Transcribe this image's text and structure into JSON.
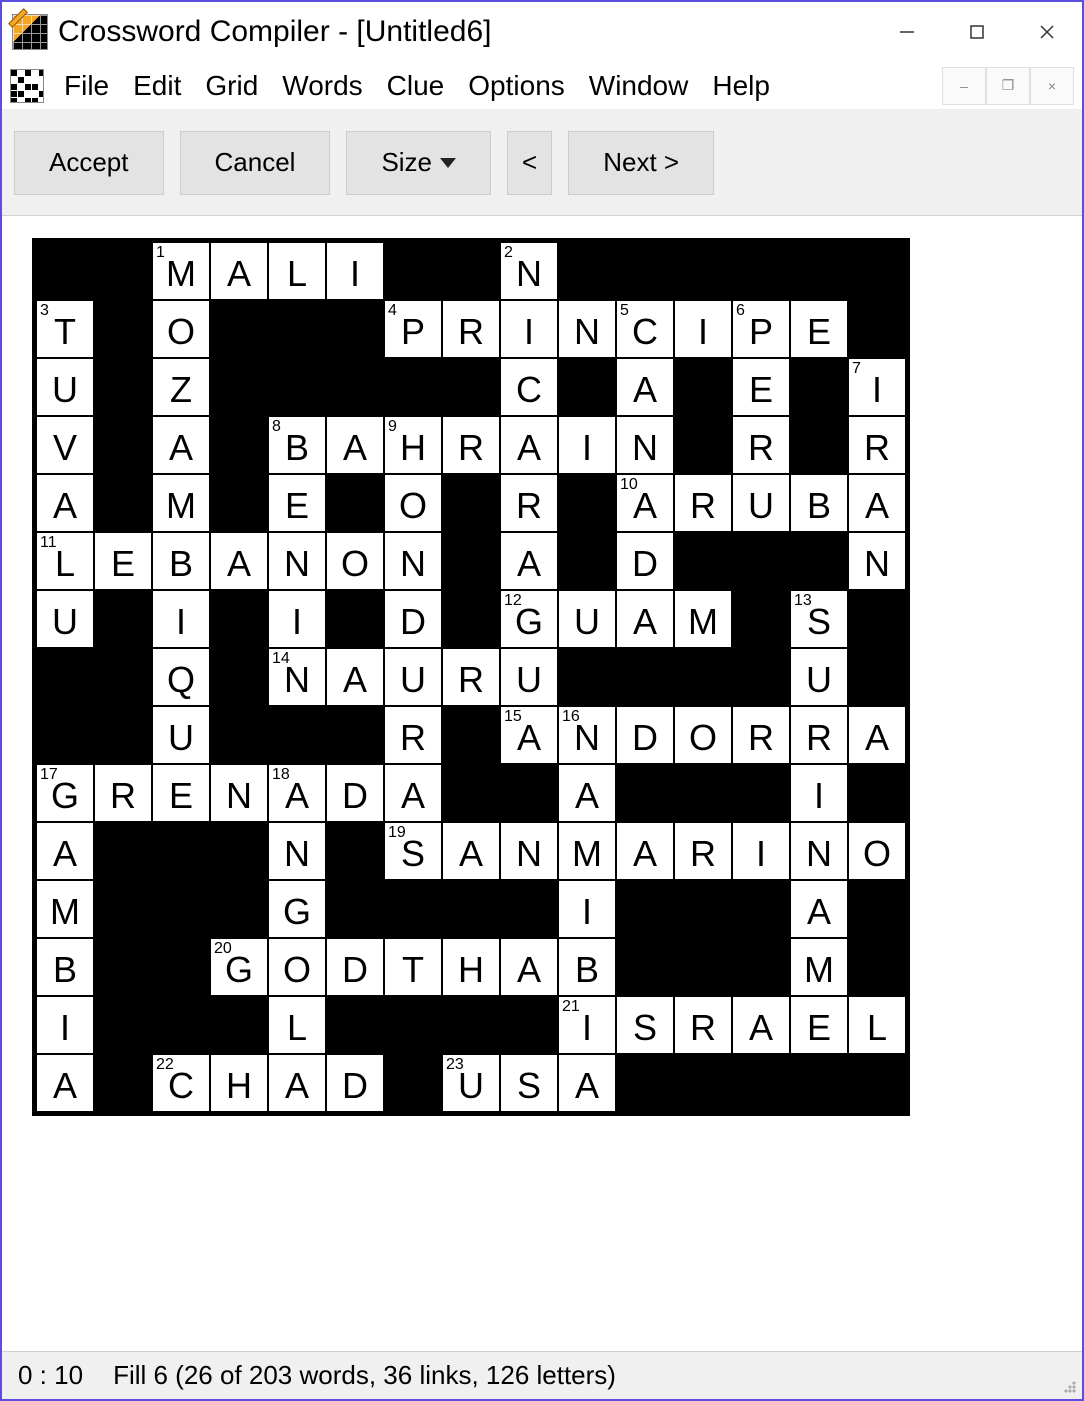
{
  "title": "Crossword Compiler - [Untitled6]",
  "menu": {
    "file": "File",
    "edit": "Edit",
    "grid": "Grid",
    "words": "Words",
    "clue": "Clue",
    "options": "Options",
    "window": "Window",
    "help": "Help"
  },
  "toolbar": {
    "accept": "Accept",
    "cancel": "Cancel",
    "size": "Size",
    "prev": "<",
    "next": "Next  >"
  },
  "status": {
    "timer": "0 : 10",
    "info": "Fill 6 (26 of 203 words, 36 links, 126 letters)"
  },
  "grid": {
    "rows": 15,
    "cols": 15,
    "cells": [
      {
        "r": 0,
        "c": 2,
        "n": "1",
        "l": "M"
      },
      {
        "r": 0,
        "c": 3,
        "l": "A"
      },
      {
        "r": 0,
        "c": 4,
        "l": "L"
      },
      {
        "r": 0,
        "c": 5,
        "l": "I"
      },
      {
        "r": 0,
        "c": 8,
        "n": "2",
        "l": "N"
      },
      {
        "r": 1,
        "c": 0,
        "n": "3",
        "l": "T"
      },
      {
        "r": 1,
        "c": 2,
        "l": "O"
      },
      {
        "r": 1,
        "c": 6,
        "n": "4",
        "l": "P"
      },
      {
        "r": 1,
        "c": 7,
        "l": "R"
      },
      {
        "r": 1,
        "c": 8,
        "l": "I"
      },
      {
        "r": 1,
        "c": 9,
        "l": "N"
      },
      {
        "r": 1,
        "c": 10,
        "n": "5",
        "l": "C"
      },
      {
        "r": 1,
        "c": 11,
        "l": "I"
      },
      {
        "r": 1,
        "c": 12,
        "n": "6",
        "l": "P"
      },
      {
        "r": 1,
        "c": 13,
        "l": "E"
      },
      {
        "r": 2,
        "c": 0,
        "l": "U"
      },
      {
        "r": 2,
        "c": 2,
        "l": "Z"
      },
      {
        "r": 2,
        "c": 8,
        "l": "C"
      },
      {
        "r": 2,
        "c": 10,
        "l": "A"
      },
      {
        "r": 2,
        "c": 12,
        "l": "E"
      },
      {
        "r": 2,
        "c": 14,
        "n": "7",
        "l": "I"
      },
      {
        "r": 3,
        "c": 0,
        "l": "V"
      },
      {
        "r": 3,
        "c": 2,
        "l": "A"
      },
      {
        "r": 3,
        "c": 4,
        "n": "8",
        "l": "B"
      },
      {
        "r": 3,
        "c": 5,
        "l": "A"
      },
      {
        "r": 3,
        "c": 6,
        "n": "9",
        "l": "H"
      },
      {
        "r": 3,
        "c": 7,
        "l": "R"
      },
      {
        "r": 3,
        "c": 8,
        "l": "A"
      },
      {
        "r": 3,
        "c": 9,
        "l": "I"
      },
      {
        "r": 3,
        "c": 10,
        "l": "N"
      },
      {
        "r": 3,
        "c": 12,
        "l": "R"
      },
      {
        "r": 3,
        "c": 14,
        "l": "R"
      },
      {
        "r": 4,
        "c": 0,
        "l": "A"
      },
      {
        "r": 4,
        "c": 2,
        "l": "M"
      },
      {
        "r": 4,
        "c": 4,
        "l": "E"
      },
      {
        "r": 4,
        "c": 6,
        "l": "O"
      },
      {
        "r": 4,
        "c": 8,
        "l": "R"
      },
      {
        "r": 4,
        "c": 10,
        "n": "10",
        "l": "A"
      },
      {
        "r": 4,
        "c": 11,
        "l": "R"
      },
      {
        "r": 4,
        "c": 12,
        "l": "U"
      },
      {
        "r": 4,
        "c": 13,
        "l": "B"
      },
      {
        "r": 4,
        "c": 14,
        "l": "A"
      },
      {
        "r": 5,
        "c": 0,
        "n": "11",
        "l": "L"
      },
      {
        "r": 5,
        "c": 1,
        "l": "E"
      },
      {
        "r": 5,
        "c": 2,
        "l": "B"
      },
      {
        "r": 5,
        "c": 3,
        "l": "A"
      },
      {
        "r": 5,
        "c": 4,
        "l": "N"
      },
      {
        "r": 5,
        "c": 5,
        "l": "O"
      },
      {
        "r": 5,
        "c": 6,
        "l": "N"
      },
      {
        "r": 5,
        "c": 8,
        "l": "A"
      },
      {
        "r": 5,
        "c": 10,
        "l": "D"
      },
      {
        "r": 5,
        "c": 14,
        "l": "N"
      },
      {
        "r": 6,
        "c": 0,
        "l": "U"
      },
      {
        "r": 6,
        "c": 2,
        "l": "I"
      },
      {
        "r": 6,
        "c": 4,
        "l": "I"
      },
      {
        "r": 6,
        "c": 6,
        "l": "D"
      },
      {
        "r": 6,
        "c": 8,
        "n": "12",
        "l": "G"
      },
      {
        "r": 6,
        "c": 9,
        "l": "U"
      },
      {
        "r": 6,
        "c": 10,
        "l": "A"
      },
      {
        "r": 6,
        "c": 11,
        "l": "M"
      },
      {
        "r": 6,
        "c": 13,
        "n": "13",
        "l": "S"
      },
      {
        "r": 7,
        "c": 2,
        "l": "Q"
      },
      {
        "r": 7,
        "c": 4,
        "n": "14",
        "l": "N"
      },
      {
        "r": 7,
        "c": 5,
        "l": "A"
      },
      {
        "r": 7,
        "c": 6,
        "l": "U"
      },
      {
        "r": 7,
        "c": 7,
        "l": "R"
      },
      {
        "r": 7,
        "c": 8,
        "l": "U"
      },
      {
        "r": 7,
        "c": 13,
        "l": "U"
      },
      {
        "r": 8,
        "c": 2,
        "l": "U"
      },
      {
        "r": 8,
        "c": 6,
        "l": "R"
      },
      {
        "r": 8,
        "c": 8,
        "n": "15",
        "l": "A"
      },
      {
        "r": 8,
        "c": 9,
        "n": "16",
        "l": "N"
      },
      {
        "r": 8,
        "c": 10,
        "l": "D"
      },
      {
        "r": 8,
        "c": 11,
        "l": "O"
      },
      {
        "r": 8,
        "c": 12,
        "l": "R"
      },
      {
        "r": 8,
        "c": 13,
        "l": "R"
      },
      {
        "r": 8,
        "c": 14,
        "l": "A"
      },
      {
        "r": 9,
        "c": 0,
        "n": "17",
        "l": "G"
      },
      {
        "r": 9,
        "c": 1,
        "l": "R"
      },
      {
        "r": 9,
        "c": 2,
        "l": "E"
      },
      {
        "r": 9,
        "c": 3,
        "l": "N"
      },
      {
        "r": 9,
        "c": 4,
        "n": "18",
        "l": "A"
      },
      {
        "r": 9,
        "c": 5,
        "l": "D"
      },
      {
        "r": 9,
        "c": 6,
        "l": "A"
      },
      {
        "r": 9,
        "c": 9,
        "l": "A"
      },
      {
        "r": 9,
        "c": 13,
        "l": "I"
      },
      {
        "r": 10,
        "c": 0,
        "l": "A"
      },
      {
        "r": 10,
        "c": 4,
        "l": "N"
      },
      {
        "r": 10,
        "c": 6,
        "n": "19",
        "l": "S"
      },
      {
        "r": 10,
        "c": 7,
        "l": "A"
      },
      {
        "r": 10,
        "c": 8,
        "l": "N"
      },
      {
        "r": 10,
        "c": 9,
        "l": "M"
      },
      {
        "r": 10,
        "c": 10,
        "l": "A"
      },
      {
        "r": 10,
        "c": 11,
        "l": "R"
      },
      {
        "r": 10,
        "c": 12,
        "l": "I"
      },
      {
        "r": 10,
        "c": 13,
        "l": "N"
      },
      {
        "r": 10,
        "c": 14,
        "l": "O"
      },
      {
        "r": 11,
        "c": 0,
        "l": "M"
      },
      {
        "r": 11,
        "c": 4,
        "l": "G"
      },
      {
        "r": 11,
        "c": 9,
        "l": "I"
      },
      {
        "r": 11,
        "c": 13,
        "l": "A"
      },
      {
        "r": 12,
        "c": 0,
        "l": "B"
      },
      {
        "r": 12,
        "c": 3,
        "n": "20",
        "l": "G"
      },
      {
        "r": 12,
        "c": 4,
        "l": "O"
      },
      {
        "r": 12,
        "c": 5,
        "l": "D"
      },
      {
        "r": 12,
        "c": 6,
        "l": "T"
      },
      {
        "r": 12,
        "c": 7,
        "l": "H"
      },
      {
        "r": 12,
        "c": 8,
        "l": "A"
      },
      {
        "r": 12,
        "c": 9,
        "l": "B"
      },
      {
        "r": 12,
        "c": 13,
        "l": "M"
      },
      {
        "r": 13,
        "c": 0,
        "l": "I"
      },
      {
        "r": 13,
        "c": 4,
        "l": "L"
      },
      {
        "r": 13,
        "c": 9,
        "n": "21",
        "l": "I"
      },
      {
        "r": 13,
        "c": 10,
        "l": "S"
      },
      {
        "r": 13,
        "c": 11,
        "l": "R"
      },
      {
        "r": 13,
        "c": 12,
        "l": "A"
      },
      {
        "r": 13,
        "c": 13,
        "l": "E"
      },
      {
        "r": 13,
        "c": 14,
        "l": "L"
      },
      {
        "r": 14,
        "c": 0,
        "l": "A"
      },
      {
        "r": 14,
        "c": 2,
        "n": "22",
        "l": "C"
      },
      {
        "r": 14,
        "c": 3,
        "l": "H"
      },
      {
        "r": 14,
        "c": 4,
        "l": "A"
      },
      {
        "r": 14,
        "c": 5,
        "l": "D"
      },
      {
        "r": 14,
        "c": 7,
        "n": "23",
        "l": "U"
      },
      {
        "r": 14,
        "c": 8,
        "l": "S"
      },
      {
        "r": 14,
        "c": 9,
        "l": "A"
      }
    ]
  }
}
